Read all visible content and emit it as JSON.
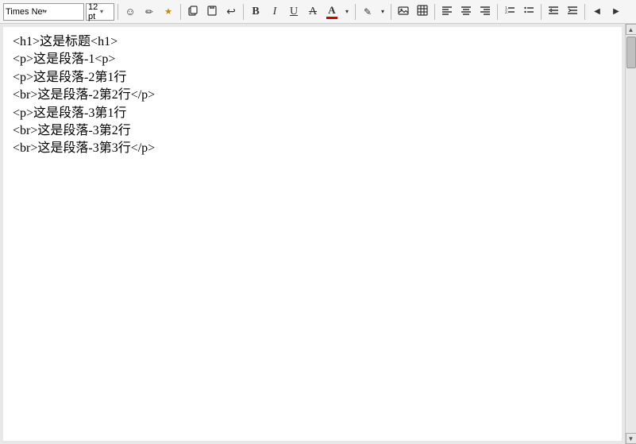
{
  "toolbar": {
    "font_name": "Times New R",
    "font_size": "12 pt",
    "font_name_placeholder": "Times New Roman",
    "buttons": {
      "smiley": "☺",
      "eraser": "⌫",
      "image": "🖼",
      "copy": "⧉",
      "paste": "⬜",
      "undo": "↩",
      "bold": "B",
      "italic": "I",
      "underline": "U",
      "strikethrough": "A",
      "font_color": "A",
      "highlight": "A",
      "insert_image": "🖼",
      "insert_table": "⊞",
      "align_left": "≡",
      "align_center": "≡",
      "align_right": "≡",
      "align_justify": "≡",
      "bullet_list": "≡",
      "numbered_list": "≡",
      "indent_left": "⇤",
      "indent_right": "⇥",
      "more_left": "◀",
      "more_right": "▶"
    }
  },
  "editor": {
    "content_lines": [
      "<h1>这是标题<h1>",
      "<p>这是段落-1<p>",
      "<p>这是段落-2第1行",
      "<br>这是段落-2第2行</p>",
      "<p>这是段落-3第1行",
      "<br>这是段落-3第2行",
      "<br>这是段落-3第3行</p>"
    ]
  }
}
